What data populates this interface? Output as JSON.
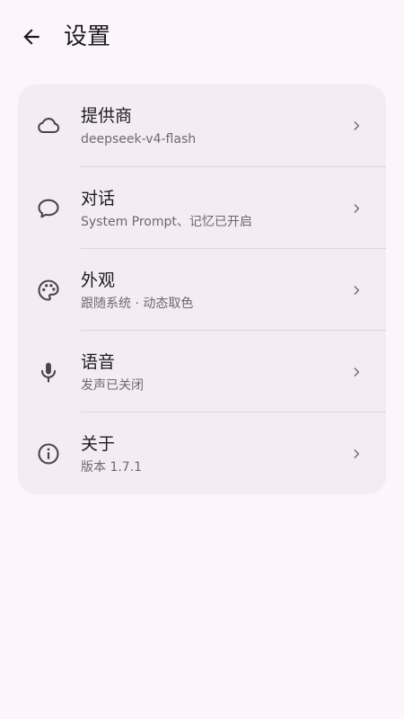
{
  "header": {
    "title": "设置",
    "back_icon": "arrow-left-icon"
  },
  "settings": {
    "items": [
      {
        "title": "提供商",
        "subtitle": "deepseek-v4-flash",
        "icon": "cloud-icon"
      },
      {
        "title": "对话",
        "subtitle": "System Prompt、记忆已开启",
        "icon": "chat-bubble-icon"
      },
      {
        "title": "外观",
        "subtitle": "跟随系统 · 动态取色",
        "icon": "palette-icon"
      },
      {
        "title": "语音",
        "subtitle": "发声已关闭",
        "icon": "microphone-icon"
      },
      {
        "title": "关于",
        "subtitle": "版本 1.7.1",
        "icon": "info-icon"
      }
    ]
  },
  "colors": {
    "background": "#fcf6fc",
    "card": "#f3edf3",
    "primary_text": "#1d1b20",
    "secondary_text": "#6d6870",
    "icon": "#49454f",
    "divider": "#dcd5dc"
  }
}
